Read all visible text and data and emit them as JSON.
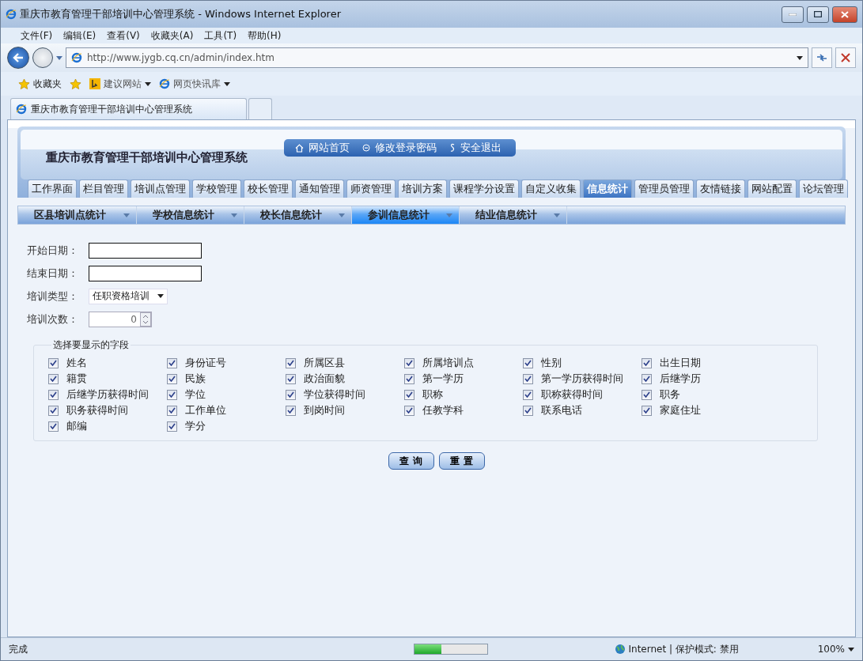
{
  "window": {
    "title": "重庆市教育管理干部培训中心管理系统 - Windows Internet Explorer"
  },
  "menu": [
    "文件(F)",
    "编辑(E)",
    "查看(V)",
    "收藏夹(A)",
    "工具(T)",
    "帮助(H)"
  ],
  "address": {
    "value": "http://www.jygb.cq.cn/admin/index.htm"
  },
  "favorites_bar": {
    "favorites": "收藏夹",
    "links": [
      "建议网站",
      "网页快讯库"
    ]
  },
  "browser_tabs": [
    {
      "label": "重庆市教育管理干部培训中心管理系统",
      "selected": true
    }
  ],
  "site": {
    "title": "重庆市教育管理干部培训中心管理系统",
    "top_links": [
      {
        "kind": "home",
        "label": "网站首页"
      },
      {
        "kind": "password",
        "label": "修改登录密码"
      },
      {
        "kind": "logout",
        "label": "安全退出"
      }
    ]
  },
  "nav_tabs": [
    {
      "label": "工作界面",
      "selected": false
    },
    {
      "label": "栏目管理",
      "selected": false
    },
    {
      "label": "培训点管理",
      "selected": false
    },
    {
      "label": "学校管理",
      "selected": false
    },
    {
      "label": "校长管理",
      "selected": false
    },
    {
      "label": "通知管理",
      "selected": false
    },
    {
      "label": "师资管理",
      "selected": false
    },
    {
      "label": "培训方案",
      "selected": false
    },
    {
      "label": "课程学分设置",
      "selected": false
    },
    {
      "label": "自定义收集",
      "selected": false
    },
    {
      "label": "信息统计",
      "selected": true
    },
    {
      "label": "管理员管理",
      "selected": false
    },
    {
      "label": "友情链接",
      "selected": false
    },
    {
      "label": "网站配置",
      "selected": false
    },
    {
      "label": "论坛管理",
      "selected": false
    }
  ],
  "sub_tabs": [
    {
      "label": "区县培训点统计",
      "selected": false
    },
    {
      "label": "学校信息统计",
      "selected": false
    },
    {
      "label": "校长信息统计",
      "selected": false
    },
    {
      "label": "参训信息统计",
      "selected": true
    },
    {
      "label": "结业信息统计",
      "selected": false
    }
  ],
  "form": {
    "start_date": {
      "label": "开始日期："
    },
    "end_date": {
      "label": "结束日期："
    },
    "training_type": {
      "label": "培训类型：",
      "value": "任职资格培训"
    },
    "training_count": {
      "label": "培训次数：",
      "value": "0"
    }
  },
  "fields_group": {
    "legend": "选择要显示的字段",
    "fields": [
      {
        "label": "姓名",
        "checked": true
      },
      {
        "label": "身份证号",
        "checked": true
      },
      {
        "label": "所属区县",
        "checked": true
      },
      {
        "label": "所属培训点",
        "checked": true
      },
      {
        "label": "性别",
        "checked": true
      },
      {
        "label": "出生日期",
        "checked": true
      },
      {
        "label": "籍贯",
        "checked": true
      },
      {
        "label": "民族",
        "checked": true
      },
      {
        "label": "政治面貌",
        "checked": true
      },
      {
        "label": "第一学历",
        "checked": true
      },
      {
        "label": "第一学历获得时间",
        "checked": true
      },
      {
        "label": "后继学历",
        "checked": true
      },
      {
        "label": "后继学历获得时间",
        "checked": true
      },
      {
        "label": "学位",
        "checked": true
      },
      {
        "label": "学位获得时间",
        "checked": true
      },
      {
        "label": "职称",
        "checked": true
      },
      {
        "label": "职称获得时间",
        "checked": true
      },
      {
        "label": "职务",
        "checked": true
      },
      {
        "label": "职务获得时间",
        "checked": true
      },
      {
        "label": "工作单位",
        "checked": true
      },
      {
        "label": "到岗时间",
        "checked": true
      },
      {
        "label": "任教学科",
        "checked": true
      },
      {
        "label": "联系电话",
        "checked": true
      },
      {
        "label": "家庭住址",
        "checked": true
      },
      {
        "label": "邮编",
        "checked": true
      },
      {
        "label": "学分",
        "checked": true
      }
    ]
  },
  "buttons": [
    "查 询",
    "重 置"
  ],
  "status_bar": {
    "text": "完成",
    "progress": {
      "level": 0.38
    },
    "zone": "Internet | 保护模式: 禁用",
    "zoom": "100%"
  }
}
